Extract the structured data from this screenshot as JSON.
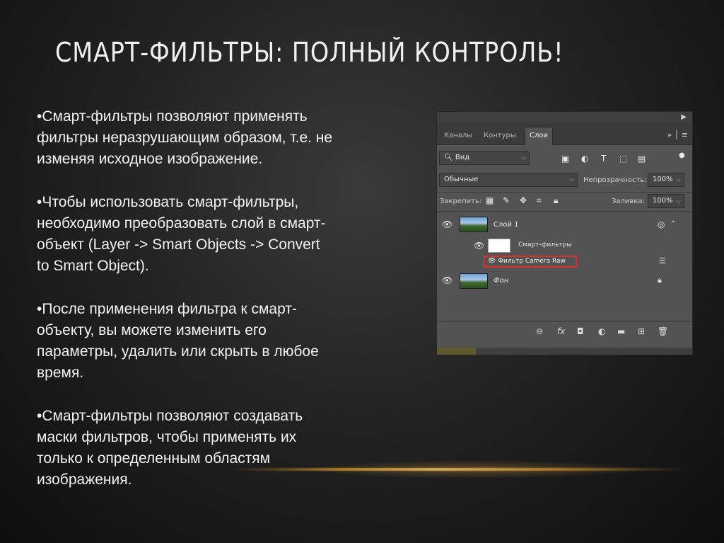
{
  "slide": {
    "title": "СМАРТ-ФИЛЬТРЫ: ПОЛНЫЙ КОНТРОЛЬ!",
    "bullets": [
      "•Смарт-фильтры позволяют применять\nфильтры неразрушающим образом, т.е. не\nизменяя исходное изображение.",
      "•Чтобы использовать смарт-фильтры,\nнеобходимо преобразовать слой в смарт-\nобъект (Layer -> Smart Objects -> Convert\nto Smart Object).",
      "•После применения фильтра к смарт-\nобъекту, вы можете изменить его\nпараметры, удалить или скрыть в любое\nвремя.",
      "•Смарт-фильтры позволяют создавать\nмаски фильтров, чтобы применять их\nтолько к определенным областям\nизображения."
    ]
  },
  "panel": {
    "tabs": [
      "Каналы",
      "Контуры",
      "Слои"
    ],
    "active_tab": "Слои",
    "filter_kind": "Вид",
    "blend_mode": "Обычные",
    "opacity_label": "Непрозрачность:",
    "opacity_value": "100%",
    "lock_label": "Закрепить:",
    "fill_label": "Заливка:",
    "fill_value": "100%",
    "layers": {
      "layer1": "Слой 1",
      "smart_filters": "Смарт-фильтры",
      "camera_raw": "Фильтр Camera Raw",
      "background": "Фон"
    },
    "highlight_color": "#d83030"
  }
}
